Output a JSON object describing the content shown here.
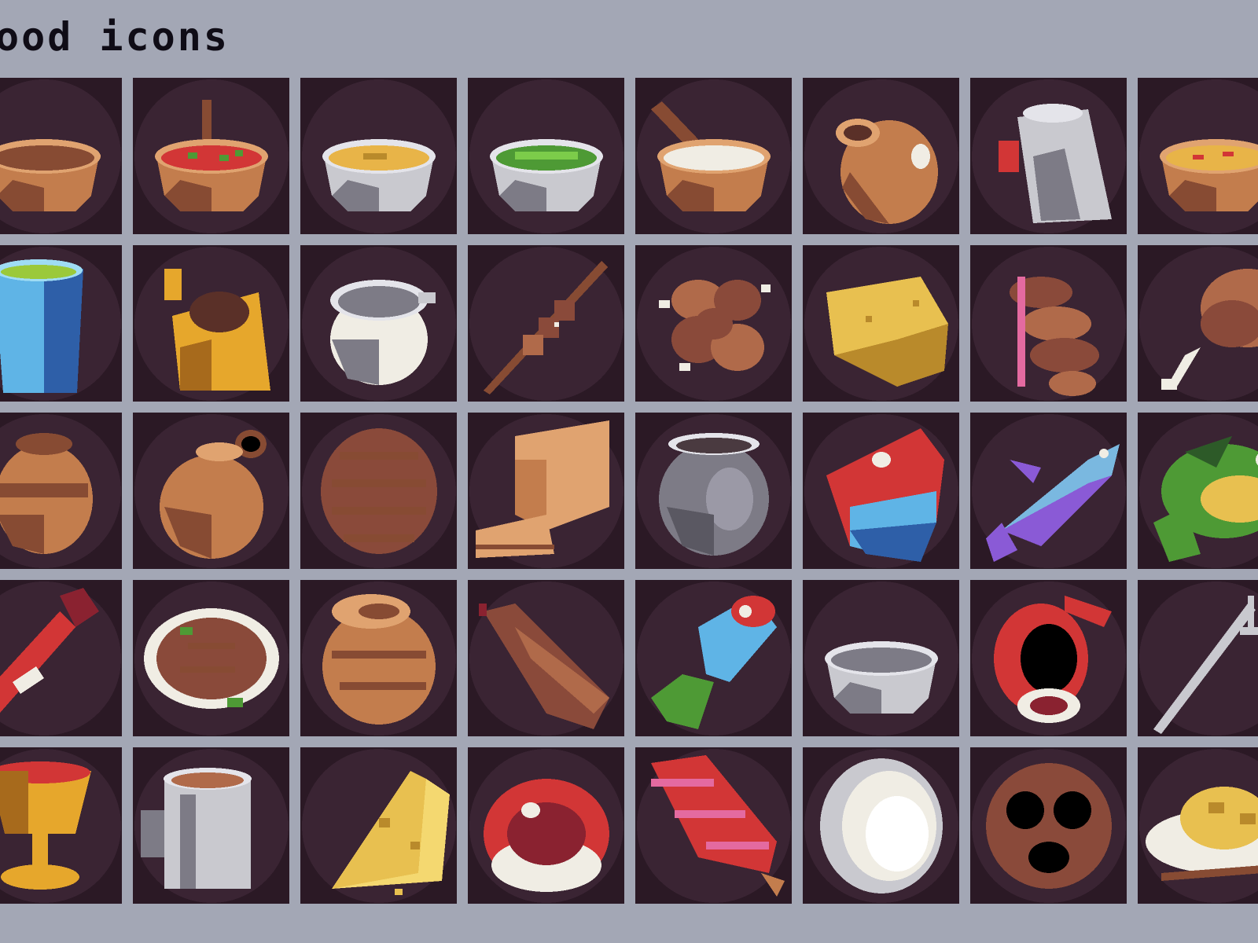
{
  "header": {
    "title": "ood icons"
  },
  "icons": [
    [
      "wooden-bowl-empty",
      "wooden-bowl-stew",
      "steel-bowl-soup",
      "steel-bowl-peas",
      "mortar-and-pestle",
      "clay-jug",
      "silver-pitcher",
      "pasta-bowl"
    ],
    [
      "blue-cup-drink",
      "golden-kettle",
      "cooking-pot",
      "meat-skewer",
      "roasted-meat-chunks",
      "cheese-wheel",
      "sausage-links",
      "chicken-leg"
    ],
    [
      "clay-pot",
      "clay-jar",
      "bread-loaf-round",
      "sliced-bread-loaf",
      "iron-cauldron",
      "salmon-steak-raw",
      "blue-fish",
      "green-fish"
    ],
    [
      "red-bottle",
      "grilled-fish-plate",
      "flour-sack",
      "sausage",
      "fish-tail-cut",
      "steel-mixing-bowl",
      "shrimp",
      "fork"
    ],
    [
      "golden-goblet",
      "tin-mug",
      "cheese-wedge",
      "fish-steak",
      "ice-cream-cone",
      "egg",
      "pretzel",
      "rice-plate"
    ]
  ],
  "colors": {
    "background": "#a3a7b5",
    "tile": "#2b1925",
    "tile_circle": "#3a2433",
    "wood": "#c37d4d",
    "wood_dark": "#874b33",
    "steel": "#c9c9cf",
    "gold": "#e6a72c",
    "red": "#d23636",
    "blue": "#5fb4e6",
    "green": "#4e9a35",
    "cream": "#f0ede4",
    "cheese": "#e8c050"
  }
}
